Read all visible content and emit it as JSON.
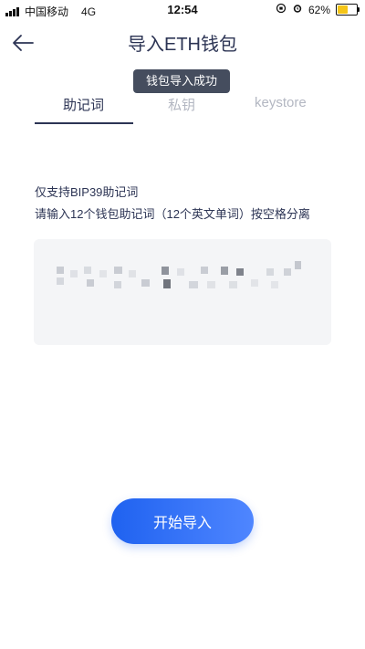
{
  "status_bar": {
    "carrier": "中国移动",
    "network": "4G",
    "time": "12:54",
    "battery": "62%",
    "battery_fill_fraction": 0.62
  },
  "header": {
    "title": "导入ETH钱包",
    "back_icon": "arrow-left-icon"
  },
  "toast": {
    "text": "钱包导入成功"
  },
  "tabs": [
    {
      "label": "助记词",
      "active": true
    },
    {
      "label": "私钥",
      "active": false
    },
    {
      "label": "keystore",
      "active": false
    }
  ],
  "instructions": {
    "line1": "仅支持BIP39助记词",
    "line2": "请输入12个钱包助记词（12个英文单词）按空格分离"
  },
  "import_button": {
    "label": "开始导入"
  },
  "colors": {
    "accent": "#1f62f0",
    "title": "#2c3454",
    "inactive_tab": "#b3b7c2",
    "toast_bg": "#454d5e"
  }
}
